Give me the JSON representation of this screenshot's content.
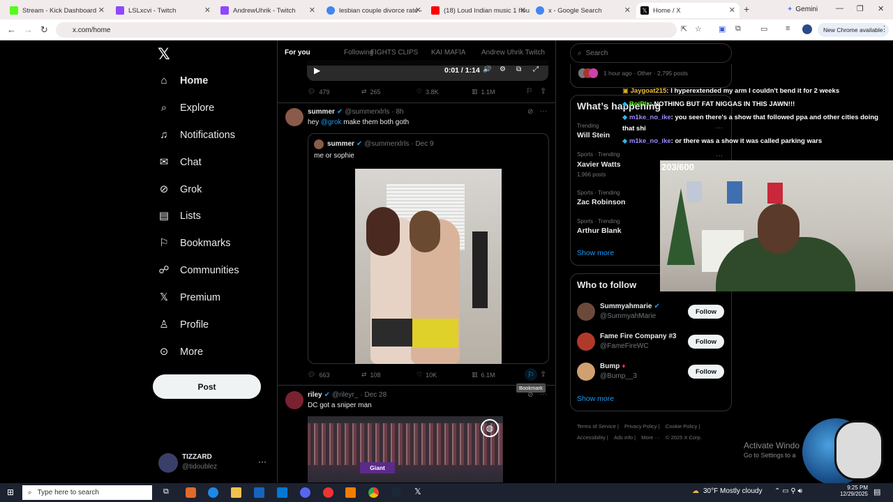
{
  "browser": {
    "tabs": [
      {
        "title": "Stream - Kick Dashboard",
        "color": "#53fc18"
      },
      {
        "title": "LSLxcvi - Twitch",
        "color": "#9146ff"
      },
      {
        "title": "AndrewUhrik - Twitch",
        "color": "#9146ff"
      },
      {
        "title": "lesbian couple divorce rate - ",
        "color": "#4285f4"
      },
      {
        "title": "(18) Loud Indian music 1 hou",
        "color": "#ff0000"
      },
      {
        "title": "x - Google Search",
        "color": "#4285f4"
      },
      {
        "title": "Home / X",
        "color": "#000000"
      }
    ],
    "gemini": "Gemini",
    "url": "x.com/home",
    "new_chrome": "New Chrome available"
  },
  "nav": {
    "items": [
      "Home",
      "Explore",
      "Notifications",
      "Chat",
      "Grok",
      "Lists",
      "Bookmarks",
      "Communities",
      "Premium",
      "Profile",
      "More"
    ],
    "post": "Post",
    "user_name": "TIZZARD",
    "user_handle": "@tidoublez"
  },
  "feed_tabs": [
    "For you",
    "Following",
    "FIGHTS CLIPS",
    "KAI MAFIA",
    "Andrew Uhrik Twitch"
  ],
  "video": {
    "time": "0:01 / 1:14"
  },
  "post1_stats": {
    "replies": "479",
    "reposts": "265",
    "likes": "3.8K",
    "views": "1.1M"
  },
  "post2": {
    "name": "summer",
    "handle": "@summerxlrls",
    "time": "· 8h",
    "text_pre": "hey ",
    "mention": "@grok",
    "text_post": " make them both goth",
    "quote": {
      "name": "summer",
      "handle": "@summerxlrls",
      "time": "· Dec 9",
      "text": "me or sophie"
    },
    "stats": {
      "replies": "663",
      "reposts": "108",
      "likes": "10K",
      "views": "6.1M"
    },
    "tooltip": "Bookmark"
  },
  "post3": {
    "name": "riley",
    "handle": "@rileyr_",
    "time": "· Dec 28",
    "text": "DC got a sniper man",
    "img_label": "Giant"
  },
  "right": {
    "search": "Search",
    "top_meta": "1 hour ago · Other · 2,795 posts",
    "happening": "What’s happening",
    "trends": [
      {
        "meta": "Trending",
        "title": "Will Stein",
        "count": ""
      },
      {
        "meta": "Sports · Trending",
        "title": "Xavier Watts",
        "count": "1,966 posts"
      },
      {
        "meta": "Sports · Trending",
        "title": "Zac Robinson",
        "count": ""
      },
      {
        "meta": "Sports · Trending",
        "title": "Arthur Blank",
        "count": ""
      }
    ],
    "show_more": "Show more",
    "who_to_follow": "Who to follow",
    "follow": [
      {
        "name": "Summyahmarie",
        "handle": "@SummyahMarie"
      },
      {
        "name": "Fame Fire Company #3",
        "handle": "@FameFireWC"
      },
      {
        "name": "Bump",
        "handle": "@Bump__3"
      }
    ],
    "follow_btn": "Follow",
    "show_more2": "Show more",
    "footer": [
      "Terms of Service",
      "Privacy Policy",
      "Cookie Policy",
      "Accessibility",
      "Ads info",
      "More ···",
      "© 2025 X Corp."
    ]
  },
  "overlay": {
    "chat": [
      {
        "user": "Jaygoat215",
        "msg": ": I hyperextended my arm I couldn't bend it for 2 weeks"
      },
      {
        "user": "BoiPlx",
        "msg": ": NOTHING BUT FAT NIGGAS IN THIS JAWN!!!"
      },
      {
        "user": "m1ke_no_ike",
        "msg": ": you seen there's a show that followed ppa and other cities doing"
      },
      {
        "user": "",
        "msg": "that shi"
      },
      {
        "user": "m1ke_no_ike",
        "msg": ": or there was a show it was called parking wars"
      }
    ],
    "counter": "203/600",
    "activate1": "Activate Windo",
    "activate2": "Go to Settings to a"
  },
  "taskbar": {
    "search": "Type here to search",
    "weather": "30°F  Mostly cloudy",
    "time": "9:25 PM",
    "date": "12/29/2025"
  }
}
